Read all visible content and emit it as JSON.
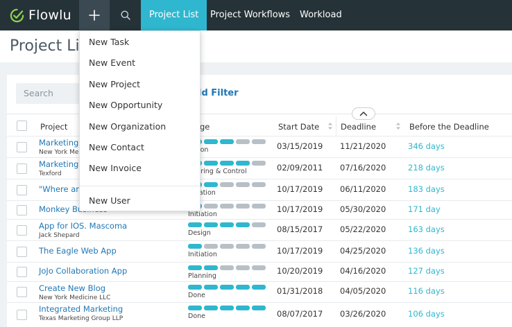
{
  "app": {
    "name": "Flowlu",
    "accent": "#2fb7cf",
    "topbar_color": "#253237",
    "link_color": "#1f77b4"
  },
  "nav": {
    "tabs": [
      {
        "label": "Project List",
        "active": true
      },
      {
        "label": "Project Workflows",
        "active": false
      },
      {
        "label": "Workload",
        "active": false
      }
    ]
  },
  "page": {
    "title": "Project List"
  },
  "filter": {
    "search_placeholder": "Search",
    "add_filter_label": "ld Filter"
  },
  "table": {
    "columns": [
      "Project",
      "ge",
      "Start Date",
      "Deadline",
      "Before the Deadline"
    ],
    "rows": [
      {
        "name": "Marketing f",
        "client": "New York Me",
        "stage": "Execution",
        "stage_text": "cution",
        "stage_progress": 3,
        "start": "03/15/2019",
        "deadline": "11/21/2020",
        "remaining": "346 days"
      },
      {
        "name": "Marketing f",
        "client": "Texford",
        "stage": "Monitoring & Control",
        "stage_text": "nitoring & Control",
        "stage_progress": 4,
        "start": "02/09/2011",
        "deadline": "07/16/2020",
        "remaining": "218 days"
      },
      {
        "name": "\"Where am",
        "client": "",
        "stage": "Preparation",
        "stage_text": "paration",
        "stage_progress": 2,
        "start": "10/17/2019",
        "deadline": "06/11/2020",
        "remaining": "183 days"
      },
      {
        "name": "Monkey Business",
        "client": "",
        "stage": "Initiation",
        "stage_text": "Initiation",
        "stage_progress": 1,
        "start": "10/17/2019",
        "deadline": "05/30/2020",
        "remaining": "171 day"
      },
      {
        "name": "App for IOS. Mascoma",
        "client": "Jack Shepard",
        "stage": "Design",
        "stage_text": "Design",
        "stage_progress": 4,
        "start": "08/15/2017",
        "deadline": "05/22/2020",
        "remaining": "163 days"
      },
      {
        "name": "The Eagle Web App",
        "client": "",
        "stage": "Initiation",
        "stage_text": "Initiation",
        "stage_progress": 1,
        "start": "10/17/2019",
        "deadline": "04/25/2020",
        "remaining": "136 days"
      },
      {
        "name": "JoJo Collaboration App",
        "client": "",
        "stage": "Planning",
        "stage_text": "Planning",
        "stage_progress": 2,
        "start": "10/20/2019",
        "deadline": "04/16/2020",
        "remaining": "127 days"
      },
      {
        "name": "Create New Blog",
        "client": "New York Medicine LLC",
        "stage": "Done",
        "stage_text": "Done",
        "stage_progress": 5,
        "start": "01/31/2018",
        "deadline": "04/05/2020",
        "remaining": "116 days"
      },
      {
        "name": "Integrated Marketing",
        "client": "Texas Marketing Group LLP",
        "stage": "Done",
        "stage_text": "Done",
        "stage_progress": 5,
        "start": "08/07/2017",
        "deadline": "03/26/2020",
        "remaining": "106 days"
      }
    ]
  },
  "dropdown": {
    "items": [
      "New Task",
      "New Event",
      "New Project",
      "New Opportunity",
      "New Organization",
      "New Contact",
      "New Invoice"
    ],
    "footer_item": "New User"
  },
  "icons": {
    "logo": "check-circle-icon",
    "plus": "plus-icon",
    "search": "search-icon",
    "sort": "sort-icon",
    "collapse": "chevron-up-icon"
  }
}
